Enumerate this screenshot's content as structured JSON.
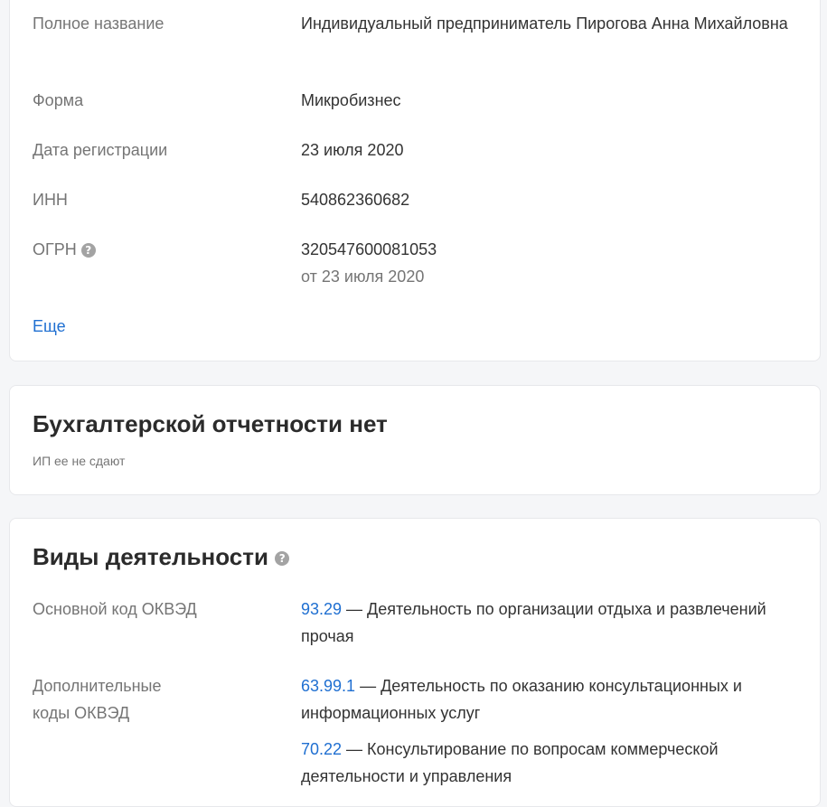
{
  "details": {
    "full_name_label": "Полное название",
    "full_name_value": "Индивидуальный предприниматель Пирогова Анна Михайловна",
    "form_label": "Форма",
    "form_value": "Микробизнес",
    "reg_date_label": "Дата регистрации",
    "reg_date_value": "23 июля 2020",
    "inn_label": "ИНН",
    "inn_value": "540862360682",
    "ogrn_label": "ОГРН",
    "ogrn_value": "320547600081053",
    "ogrn_date": "от 23 июля 2020",
    "more_link": "Еще"
  },
  "accounting": {
    "title": "Бухгалтерской отчетности нет",
    "note": "ИП ее не сдают"
  },
  "activities": {
    "title": "Виды деятельности",
    "main_label": "Основной код ОКВЭД",
    "main_code": "93.29",
    "main_desc": " — Деятельность по организации отдыха и развлечений прочая",
    "extra_label": "Дополнительные коды ОКВЭД",
    "extra": [
      {
        "code": "63.99.1",
        "desc": " — Деятельность по оказанию консультационных и информационных услуг"
      },
      {
        "code": "70.22",
        "desc": " — Консультирование по вопросам коммерческой деятельности и управления"
      }
    ]
  },
  "icons": {
    "help": "question-circle-icon",
    "help_glyph": "?"
  }
}
